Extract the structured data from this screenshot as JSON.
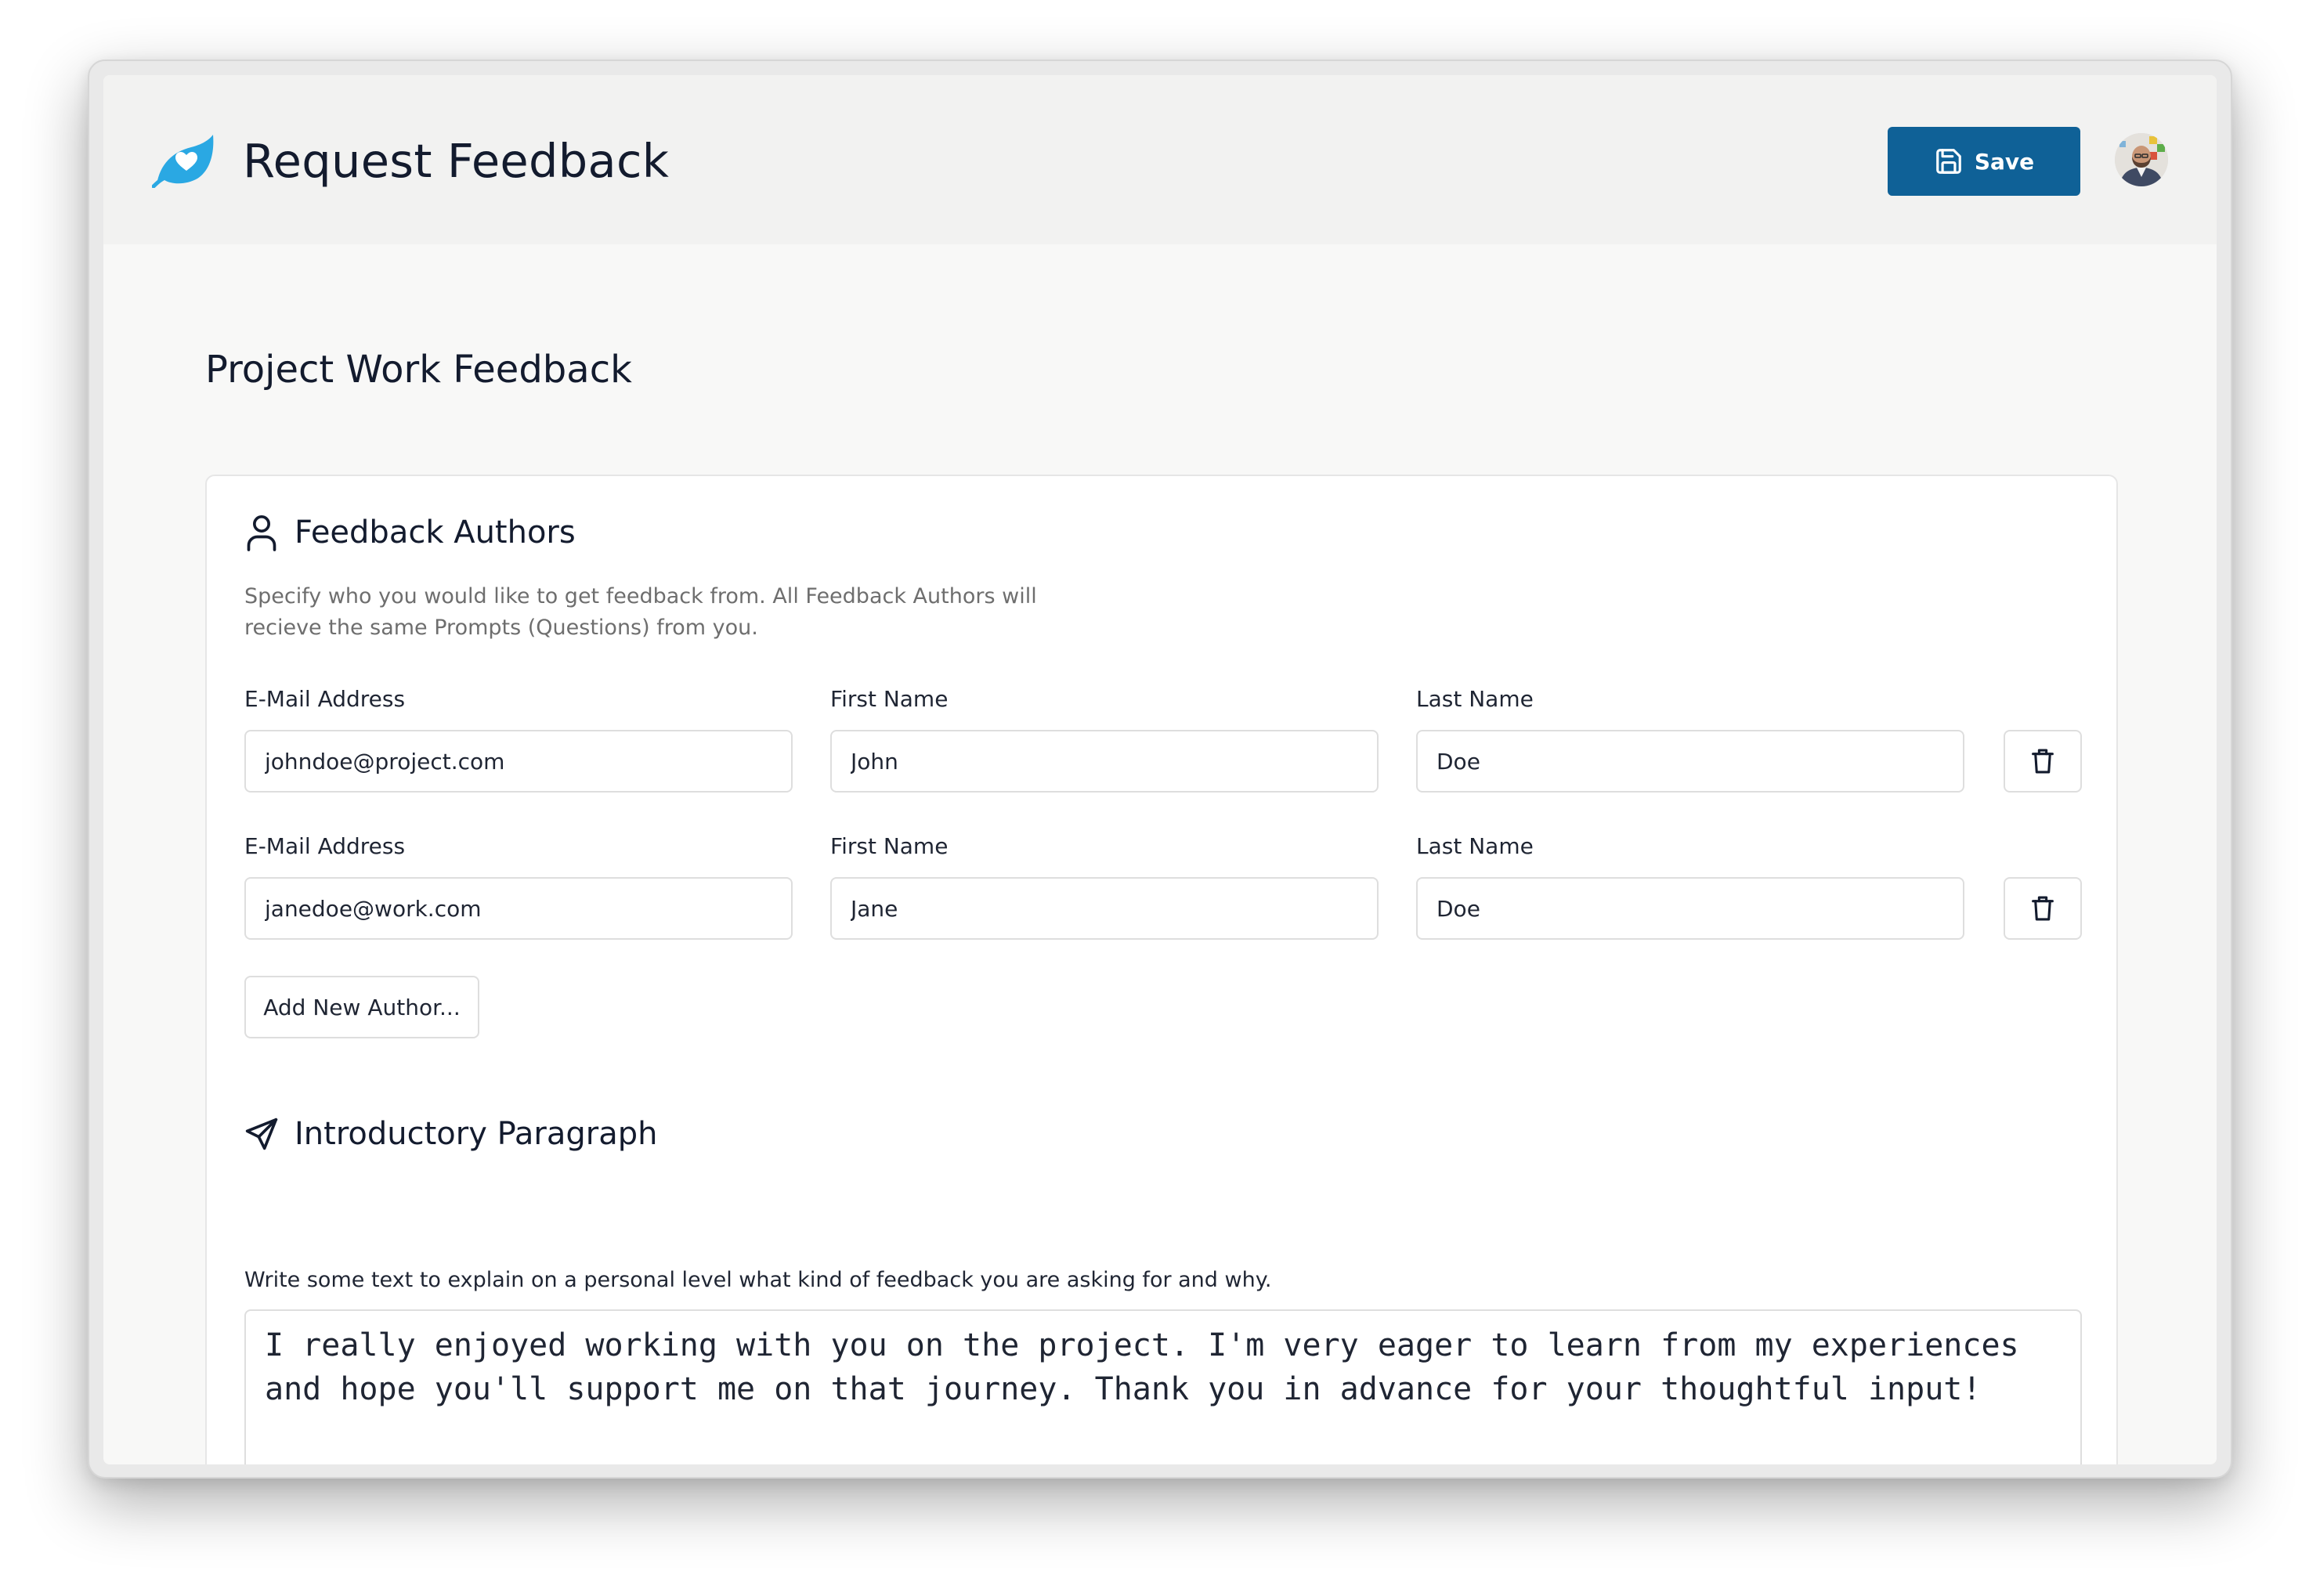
{
  "header": {
    "app_title": "Request Feedback",
    "save_label": "Save",
    "brand_color": "#0f6197",
    "logo_color": "#2aa8e3"
  },
  "page": {
    "title": "Project Work Feedback"
  },
  "authors_section": {
    "title": "Feedback Authors",
    "help_text": "Specify who you would like to get feedback from. All Feedback Authors will recieve the same Prompts (Questions) from you.",
    "labels": {
      "email": "E-Mail Address",
      "first_name": "First Name",
      "last_name": "Last Name"
    },
    "authors": [
      {
        "email": "johndoe@project.com",
        "first_name": "John",
        "last_name": "Doe"
      },
      {
        "email": "janedoe@work.com",
        "first_name": "Jane",
        "last_name": "Doe"
      }
    ],
    "add_author_label": "Add New Author..."
  },
  "intro_section": {
    "title": "Introductory Paragraph",
    "help_text": "Write some text to explain on a personal level what kind of feedback you are asking for and why.",
    "text": "I really enjoyed working with you on the project. I'm very eager to learn from my experiences and hope you'll support me on that journey. Thank you in advance for your thoughtful input!"
  }
}
